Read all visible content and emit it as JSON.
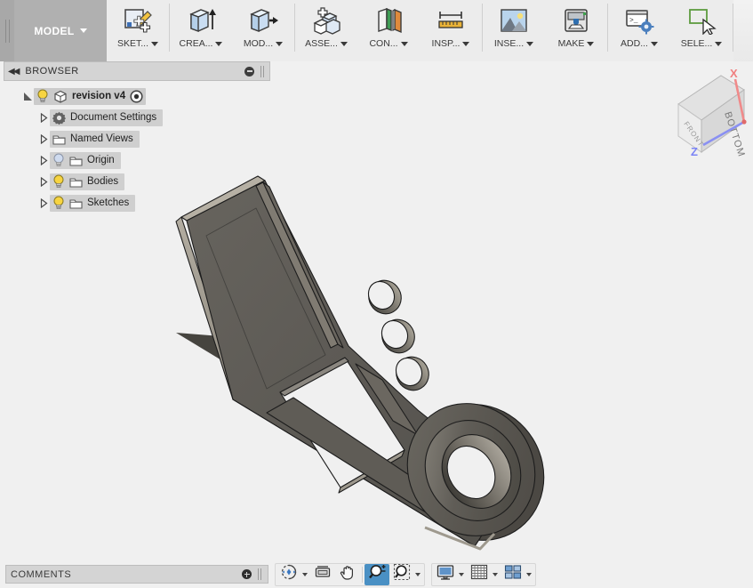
{
  "app": {
    "workspace_label": "MODEL",
    "workspace_icon": "chevron-down-icon"
  },
  "toolbar": {
    "items": [
      {
        "label": "SKET...",
        "icon": "sketch-create-icon",
        "name": "sketch"
      },
      {
        "label": "CREA...",
        "icon": "extrude-create-icon",
        "name": "create"
      },
      {
        "label": "MOD...",
        "icon": "modify-push-pull-icon",
        "name": "modify"
      },
      {
        "label": "ASSE...",
        "icon": "assemble-blocks-icon",
        "name": "assemble"
      },
      {
        "label": "CON...",
        "icon": "construct-plane-icon",
        "name": "construct"
      },
      {
        "label": "INSP...",
        "icon": "inspect-measure-icon",
        "name": "inspect"
      },
      {
        "label": "INSE...",
        "icon": "insert-image-icon",
        "name": "insert"
      },
      {
        "label": "MAKE",
        "icon": "make-3dprint-icon",
        "name": "make"
      },
      {
        "label": "ADD...",
        "icon": "addins-script-icon",
        "name": "add-ins"
      },
      {
        "label": "SELE...",
        "icon": "select-cursor-icon",
        "name": "select"
      }
    ]
  },
  "browser": {
    "title": "BROWSER",
    "collapse_icon": "double-left-arrow-icon",
    "minimize_icon": "circle-minus-icon",
    "tree": [
      {
        "label": "revision v4",
        "indent": 0,
        "expander": "expanded",
        "bulb": "on",
        "type_icon": "cube-icon",
        "trailing_icon": "target-icon",
        "bold": true
      },
      {
        "label": "Document Settings",
        "indent": 1,
        "expander": "collapsed",
        "bulb": "none",
        "type_icon": "gear-icon",
        "bold": false
      },
      {
        "label": "Named Views",
        "indent": 1,
        "expander": "collapsed",
        "bulb": "none",
        "type_icon": "folder-icon",
        "bold": false
      },
      {
        "label": "Origin",
        "indent": 1,
        "expander": "collapsed",
        "bulb": "off",
        "type_icon": "folder-icon",
        "bold": false
      },
      {
        "label": "Bodies",
        "indent": 1,
        "expander": "collapsed",
        "bulb": "on",
        "type_icon": "folder-icon",
        "bold": false
      },
      {
        "label": "Sketches",
        "indent": 1,
        "expander": "collapsed",
        "bulb": "on",
        "type_icon": "folder-icon",
        "bold": false
      }
    ]
  },
  "viewcube": {
    "face_top_label": "BOTTOM",
    "face_side_label": "FRONT",
    "axis_x_label": "X",
    "axis_z_label": "Z",
    "axis_x_color": "#f08080",
    "axis_z_color": "#7b84f5"
  },
  "canvas": {
    "background_color": "#f0f0f0",
    "model_name": "rocker-arm-bracket",
    "model_body_color": "#5d5a55",
    "model_edge_color": "#9a958b",
    "model_shadow_color": "#3f3d39",
    "model_outline_color": "#1d1d1d"
  },
  "comments": {
    "label": "COMMENTS",
    "add_icon": "circle-plus-icon"
  },
  "navbar": {
    "groups": [
      {
        "name": "navigation",
        "buttons": [
          {
            "name": "orbit",
            "icon": "orbit-icon",
            "caret": true,
            "active": false
          },
          {
            "name": "look-at",
            "icon": "look-at-icon",
            "caret": false,
            "active": false
          },
          {
            "name": "pan",
            "icon": "pan-hand-icon",
            "caret": false,
            "active": false
          },
          {
            "name": "zoom",
            "icon": "zoom-magnifier-icon",
            "caret": false,
            "active": true
          },
          {
            "name": "zoom-window",
            "icon": "zoom-window-icon",
            "caret": true,
            "active": false
          }
        ]
      },
      {
        "name": "display",
        "buttons": [
          {
            "name": "display-settings",
            "icon": "monitor-icon",
            "caret": true,
            "active": false
          },
          {
            "name": "grid-snaps",
            "icon": "grid-icon",
            "caret": true,
            "active": false
          },
          {
            "name": "viewport-layout",
            "icon": "viewports-icon",
            "caret": true,
            "active": false
          }
        ]
      }
    ]
  }
}
